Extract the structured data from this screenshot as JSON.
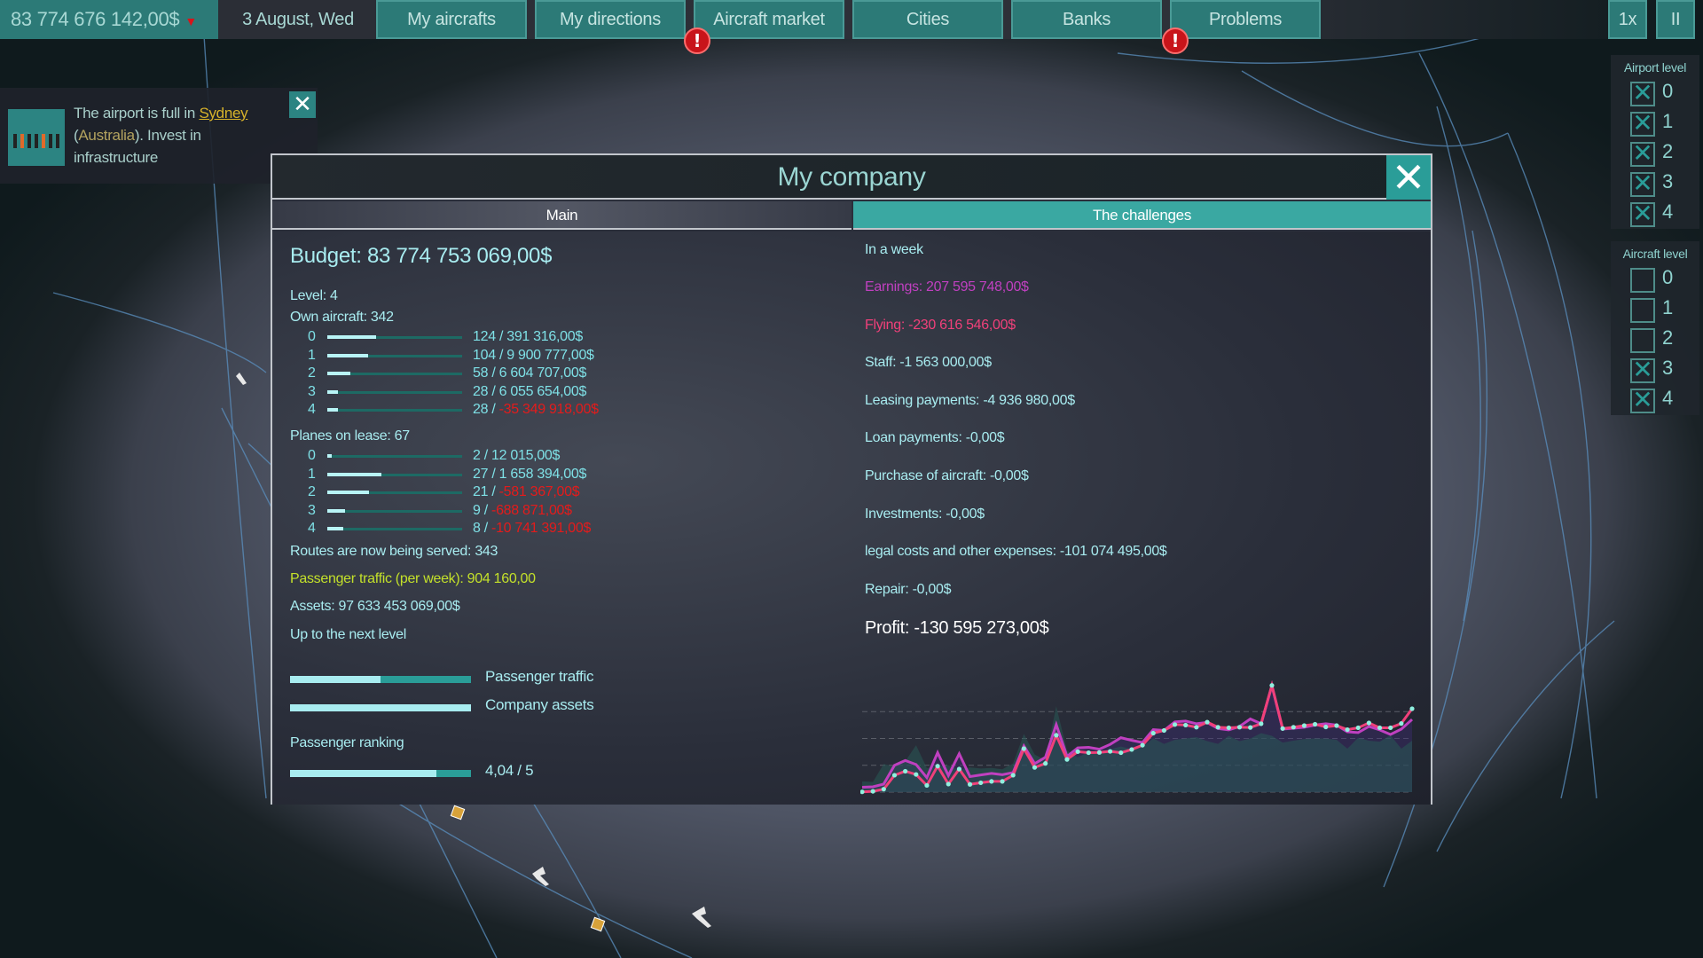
{
  "topbar": {
    "balance": "83 774 676 142,00$",
    "date": "3 August, Wed",
    "nav": [
      {
        "label": "My aircrafts",
        "alert": false
      },
      {
        "label": "My directions",
        "alert": false
      },
      {
        "label": "Aircraft market",
        "alert": true
      },
      {
        "label": "Cities",
        "alert": false
      },
      {
        "label": "Banks",
        "alert": false
      },
      {
        "label": "Problems",
        "alert": true
      }
    ],
    "alert_glyph": "!",
    "speed": "1x",
    "pause": "II"
  },
  "notification": {
    "text_prefix": "The airport is full in ",
    "city": "Sydney",
    "open_paren": "(",
    "country": "Australia",
    "text_suffix": "). Invest in infrastructure",
    "close": "✕"
  },
  "filters": {
    "airport_level": {
      "title": "Airport level",
      "items": [
        {
          "label": "0",
          "checked": true
        },
        {
          "label": "1",
          "checked": true
        },
        {
          "label": "2",
          "checked": true
        },
        {
          "label": "3",
          "checked": true
        },
        {
          "label": "4",
          "checked": true
        }
      ]
    },
    "aircraft_level": {
      "title": "Aircraft level",
      "items": [
        {
          "label": "0",
          "checked": false
        },
        {
          "label": "1",
          "checked": false
        },
        {
          "label": "2",
          "checked": false
        },
        {
          "label": "3",
          "checked": true
        },
        {
          "label": "4",
          "checked": true
        }
      ]
    }
  },
  "dialog": {
    "title": "My company",
    "close": "✕",
    "tabs": [
      {
        "label": "Main",
        "active": false
      },
      {
        "label": "The challenges",
        "active": true
      }
    ],
    "main": {
      "budget": "Budget: 83 774 753 069,00$",
      "level": "Level: 4",
      "own_aircraft": "Own aircraft: 342",
      "own_rows": [
        {
          "level": "0",
          "count": "124 / ",
          "value": "391 316,00$",
          "negative": false,
          "fill": 0.36
        },
        {
          "level": "1",
          "count": "104 / ",
          "value": "9 900 777,00$",
          "negative": false,
          "fill": 0.3
        },
        {
          "level": "2",
          "count": "58 / ",
          "value": "6 604 707,00$",
          "negative": false,
          "fill": 0.17
        },
        {
          "level": "3",
          "count": "28 / ",
          "value": "6 055 654,00$",
          "negative": false,
          "fill": 0.08
        },
        {
          "level": "4",
          "count": "28 / ",
          "value": "-35 349 918,00$",
          "negative": true,
          "fill": 0.08
        }
      ],
      "lease": "Planes on lease: 67",
      "lease_rows": [
        {
          "level": "0",
          "count": "2 / ",
          "value": "12 015,00$",
          "negative": false,
          "fill": 0.03
        },
        {
          "level": "1",
          "count": "27 / ",
          "value": "1 658 394,00$",
          "negative": false,
          "fill": 0.4
        },
        {
          "level": "2",
          "count": "21 / ",
          "value": "-581 367,00$",
          "negative": true,
          "fill": 0.31
        },
        {
          "level": "3",
          "count": "9 / ",
          "value": "-688 871,00$",
          "negative": true,
          "fill": 0.13
        },
        {
          "level": "4",
          "count": "8 / ",
          "value": "-10 741 391,00$",
          "negative": true,
          "fill": 0.12
        }
      ],
      "routes": "Routes are now being served: 343",
      "traffic": "Passenger traffic (per week): 904 160,00",
      "assets": "Assets: 97 633 453 069,00$",
      "next_level": "Up to the next level",
      "progress": [
        {
          "label": "Passenger traffic",
          "value": 0.5
        },
        {
          "label": "Company assets",
          "value": 1.0
        }
      ],
      "ranking_title": "Passenger ranking",
      "ranking_value": 0.808,
      "ranking_text": "4,04 / 5"
    },
    "challenges": {
      "period": "In a week",
      "lines": [
        {
          "text": "Earnings: 207 595 748,00$",
          "color": "#c040c0"
        },
        {
          "text": "Flying: -230 616 546,00$",
          "color": "#f0407a"
        },
        {
          "text": "Staff: -1 563 000,00$",
          "color": "#a8ecf0"
        },
        {
          "text": "Leasing payments: -4 936 980,00$",
          "color": "#a8ecf0"
        },
        {
          "text": "Loan payments: -0,00$",
          "color": "#a8ecf0"
        },
        {
          "text": "Purchase of aircraft: -0,00$",
          "color": "#a8ecf0"
        },
        {
          "text": "Investments: -0,00$",
          "color": "#a8ecf0"
        },
        {
          "text": "legal costs and other expenses: -101 074 495,00$",
          "color": "#a8ecf0"
        },
        {
          "text": "Repair: -0,00$",
          "color": "#a8ecf0"
        }
      ],
      "profit": "Profit: -130 595 273,00$"
    }
  },
  "chart_data": {
    "type": "line",
    "title": "",
    "xlabel": "",
    "ylabel": "",
    "ylim": [
      0,
      4.3
    ],
    "grid": true,
    "gridlines": [
      0,
      1,
      2,
      3
    ],
    "legend": "none",
    "series": [
      {
        "name": "Flying",
        "color": "#f0407a",
        "markers": true,
        "values": [
          0.01,
          0.03,
          0.11,
          0.63,
          0.78,
          0.66,
          0.25,
          0.97,
          0.3,
          0.86,
          0.29,
          0.35,
          0.4,
          0.4,
          0.63,
          1.62,
          0.92,
          1.07,
          2.12,
          1.22,
          1.51,
          1.47,
          1.48,
          1.52,
          1.47,
          1.59,
          1.75,
          2.2,
          2.3,
          2.52,
          2.5,
          2.42,
          2.61,
          2.42,
          2.4,
          2.42,
          2.41,
          2.55,
          3.98,
          2.37,
          2.42,
          2.48,
          2.53,
          2.43,
          2.48,
          2.33,
          2.4,
          2.58,
          2.4,
          2.4,
          2.56,
          3.11
        ]
      },
      {
        "name": "Earnings",
        "color": "#c040c0",
        "markers": false,
        "values": [
          0.18,
          0.2,
          0.3,
          1.0,
          1.18,
          1.03,
          0.54,
          1.47,
          0.62,
          1.43,
          0.58,
          0.64,
          0.7,
          0.65,
          0.73,
          1.72,
          1.06,
          1.3,
          2.52,
          1.33,
          1.65,
          1.67,
          1.6,
          1.78,
          2.03,
          1.93,
          1.85,
          2.33,
          2.3,
          2.62,
          2.65,
          2.55,
          2.6,
          2.37,
          2.32,
          2.45,
          2.73,
          2.55,
          3.97,
          2.35,
          2.38,
          2.42,
          2.5,
          2.55,
          2.5,
          2.25,
          2.22,
          2.45,
          2.32,
          2.15,
          2.35,
          2.71
        ]
      },
      {
        "name": "Income area",
        "color": "#2a4a48",
        "markers": false,
        "values": [
          0.4,
          0.38,
          1.05,
          0.95,
          1.15,
          1.75,
          0.9,
          0.95,
          1.0,
          0.82,
          0.92,
          0.88,
          0.9,
          0.85,
          1.07,
          2.17,
          1.4,
          1.2,
          3.2,
          1.55,
          1.3,
          1.5,
          1.45,
          1.6,
          1.7,
          1.6,
          1.7,
          2.0,
          1.8,
          1.95,
          2.0,
          2.05,
          1.9,
          1.8,
          2.1,
          1.9,
          2.0,
          2.2,
          2.1,
          1.85,
          1.92,
          1.98,
          2.0,
          2.0,
          1.95,
          1.62,
          2.03,
          1.92,
          1.88,
          2.12,
          1.62,
          1.92
        ]
      }
    ]
  }
}
